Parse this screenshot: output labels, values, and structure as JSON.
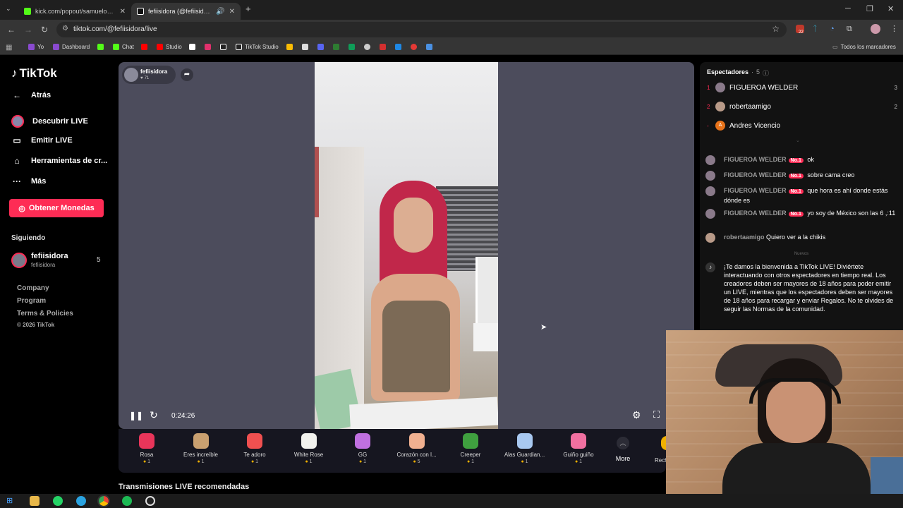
{
  "browser": {
    "tabs": [
      {
        "title": "kick.com/popout/samuelon/chat",
        "active": false
      },
      {
        "title": "fefiisidora (@fefiisidora) está en LIVE",
        "active": true
      }
    ],
    "url": "tiktok.com/@fefiisidora/live",
    "bookmarks": [
      "Yo",
      "Dashboard",
      "Chat",
      "Studio",
      "TikTok Studio"
    ],
    "all_bookmarks_label": "Todos los marcadores",
    "ext_badge": "22"
  },
  "sidebar": {
    "logo": "TikTok",
    "back": "Atrás",
    "nav": [
      "Descubrir LIVE",
      "Emitir LIVE",
      "Herramientas de cr...",
      "Más"
    ],
    "coins_button": "Obtener Monedas",
    "following_title": "Siguiendo",
    "following": {
      "name": "fefiisidora",
      "handle": "fefiisidora",
      "count": "5"
    },
    "footer": [
      "Company",
      "Program",
      "Terms & Policies"
    ],
    "copyright": "© 2026 TikTok"
  },
  "player": {
    "host_name": "fefiisidora",
    "host_likes": "71",
    "elapsed": "0:24:26"
  },
  "gifts": [
    {
      "name": "Rosa",
      "price": "1",
      "color": "#e8355a"
    },
    {
      "name": "Eres increíble",
      "price": "1",
      "color": "#c9a070"
    },
    {
      "name": "Te adoro",
      "price": "1",
      "color": "#f05050"
    },
    {
      "name": "White Rose",
      "price": "1",
      "color": "#f2f2ee"
    },
    {
      "name": "GG",
      "price": "1",
      "color": "#c070e0"
    },
    {
      "name": "Corazón con l...",
      "price": "5",
      "color": "#f0b090"
    },
    {
      "name": "Creeper",
      "price": "1",
      "color": "#3fa03f"
    },
    {
      "name": "Alas Guardian...",
      "price": "1",
      "color": "#a8c8f0"
    },
    {
      "name": "Guiño guiño",
      "price": "1",
      "color": "#f070a0"
    }
  ],
  "gifts_more": "More",
  "gifts_partial": "Rech",
  "chat": {
    "viewers_title": "Espectadores",
    "viewers_count": "5",
    "viewers": [
      {
        "rank": "1",
        "name": "FIGUEROA WELDER",
        "score": "3"
      },
      {
        "rank": "2",
        "name": "robertaamigo",
        "score": "2"
      },
      {
        "rank": "-",
        "name": "Andres Vicencio",
        "score": ""
      }
    ],
    "badge": "No.1",
    "messages": [
      {
        "user": "FIGUEROA WELDER",
        "text": "ok",
        "badge": true
      },
      {
        "user": "FIGUEROA WELDER",
        "text": "sobre cama creo",
        "badge": true
      },
      {
        "user": "FIGUEROA WELDER",
        "text": "que hora es ahí donde estás dónde es",
        "badge": true
      },
      {
        "user": "FIGUEROA WELDER",
        "text": "yo soy de México son las 6 ,:11",
        "badge": true
      },
      {
        "user": "robertaamigo",
        "text": "Quiero ver a la chikis",
        "badge": false
      }
    ],
    "new_label": "Nuevos",
    "welcome": "¡Te damos la bienvenida a TikTok LIVE! Diviértete interactuando con otros espectadores en tiempo real. Los creadores deben ser mayores de 18 años para poder emitir un LIVE, mientras que los espectadores deben ser mayores de 18 años para recargar y enviar Regalos. No te olvides de seguir las Normas de la comunidad."
  },
  "recommended_title": "Transmisiones LIVE recomendadas"
}
